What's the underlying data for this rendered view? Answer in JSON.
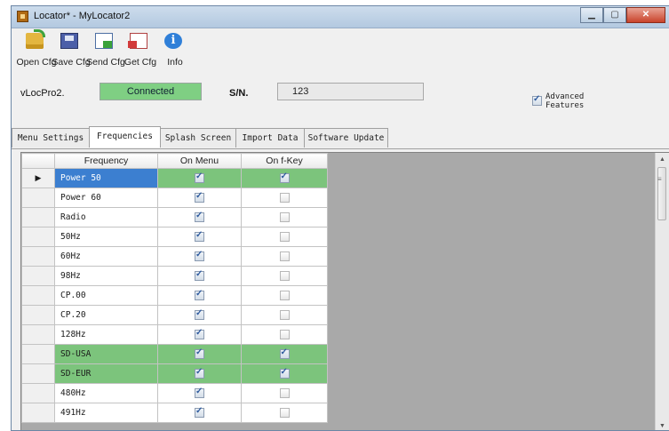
{
  "window": {
    "title": "Locator* - MyLocator2",
    "controls": {
      "minimize": "▁",
      "maximize": "▢",
      "close": "✕"
    }
  },
  "toolbar": {
    "buttons": [
      {
        "label": "Open Cfg",
        "icon": "folder-open-icon"
      },
      {
        "label": "Save Cfg",
        "icon": "save-icon"
      },
      {
        "label": "Send Cfg",
        "icon": "send-icon"
      },
      {
        "label": "Get Cfg",
        "icon": "get-icon"
      },
      {
        "label": "Info",
        "icon": "info-icon",
        "glyph": "i"
      }
    ]
  },
  "device": {
    "name": "vLocPro2.",
    "status": "Connected",
    "status_color": "#7fcf83",
    "sn_label": "S/N.",
    "sn_value": "123",
    "advanced_label": "Advanced Features",
    "advanced_checked": true
  },
  "tabs": [
    {
      "label": "Menu Settings",
      "active": false
    },
    {
      "label": "Frequencies",
      "active": true
    },
    {
      "label": "Splash Screen",
      "active": false
    },
    {
      "label": "Import Data",
      "active": false
    },
    {
      "label": "Software Update",
      "active": false
    }
  ],
  "grid": {
    "columns": [
      "Frequency",
      "On Menu",
      "On f-Key"
    ],
    "current_row_marker": "▶",
    "rows": [
      {
        "frequency": "Power 50",
        "on_menu": true,
        "on_fkey": true,
        "highlight": true,
        "selected": true
      },
      {
        "frequency": "Power 60",
        "on_menu": true,
        "on_fkey": false,
        "highlight": false,
        "selected": false
      },
      {
        "frequency": "Radio",
        "on_menu": true,
        "on_fkey": false,
        "highlight": false,
        "selected": false
      },
      {
        "frequency": "50Hz",
        "on_menu": true,
        "on_fkey": false,
        "highlight": false,
        "selected": false
      },
      {
        "frequency": "60Hz",
        "on_menu": true,
        "on_fkey": false,
        "highlight": false,
        "selected": false
      },
      {
        "frequency": "98Hz",
        "on_menu": true,
        "on_fkey": false,
        "highlight": false,
        "selected": false
      },
      {
        "frequency": "CP.00",
        "on_menu": true,
        "on_fkey": false,
        "highlight": false,
        "selected": false
      },
      {
        "frequency": "CP.20",
        "on_menu": true,
        "on_fkey": false,
        "highlight": false,
        "selected": false
      },
      {
        "frequency": "128Hz",
        "on_menu": true,
        "on_fkey": false,
        "highlight": false,
        "selected": false
      },
      {
        "frequency": "SD-USA",
        "on_menu": true,
        "on_fkey": true,
        "highlight": true,
        "selected": false
      },
      {
        "frequency": "SD-EUR",
        "on_menu": true,
        "on_fkey": true,
        "highlight": true,
        "selected": false
      },
      {
        "frequency": "480Hz",
        "on_menu": true,
        "on_fkey": false,
        "highlight": false,
        "selected": false
      },
      {
        "frequency": "491Hz",
        "on_menu": true,
        "on_fkey": false,
        "highlight": false,
        "selected": false
      }
    ]
  },
  "scrollbar": {
    "up": "▲",
    "down": "▼",
    "grip": "≡"
  }
}
